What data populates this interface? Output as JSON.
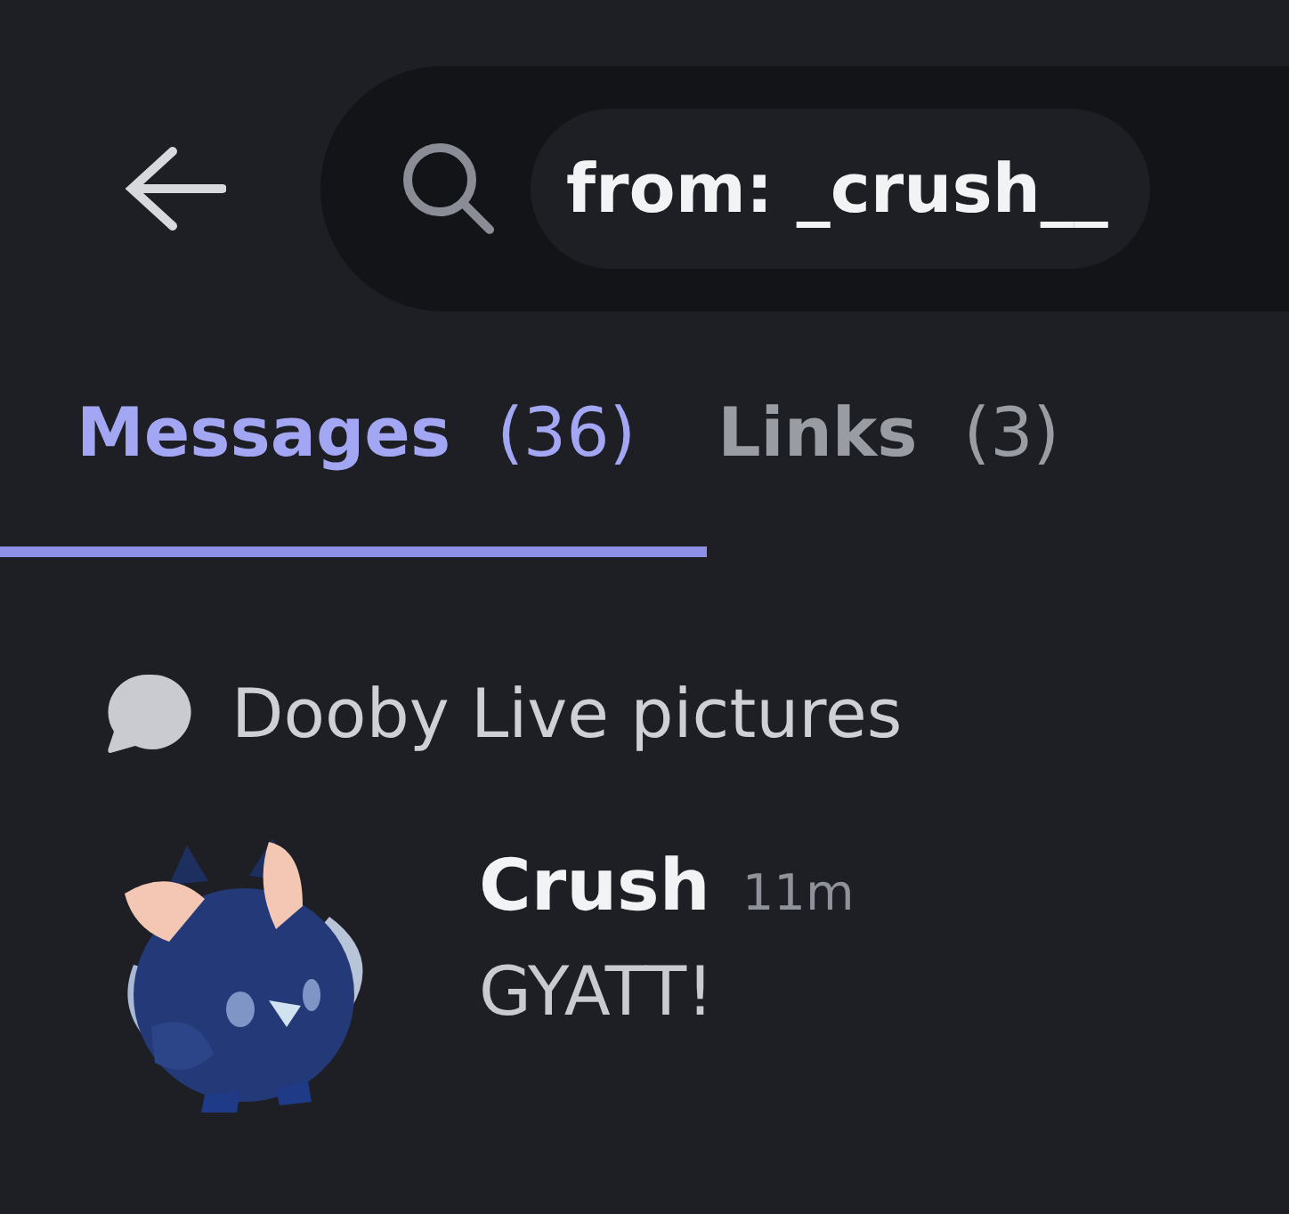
{
  "search": {
    "value": "from: _crush__"
  },
  "tabs": [
    {
      "label": "Messages",
      "count": "(36)",
      "selected": true
    },
    {
      "label": "Links",
      "count": "(3)",
      "selected": false
    }
  ],
  "results": [
    {
      "channel": "Dooby Live pictures",
      "messages": [
        {
          "author": "Crush",
          "time": "11m",
          "text": "GYATT!"
        }
      ]
    }
  ]
}
